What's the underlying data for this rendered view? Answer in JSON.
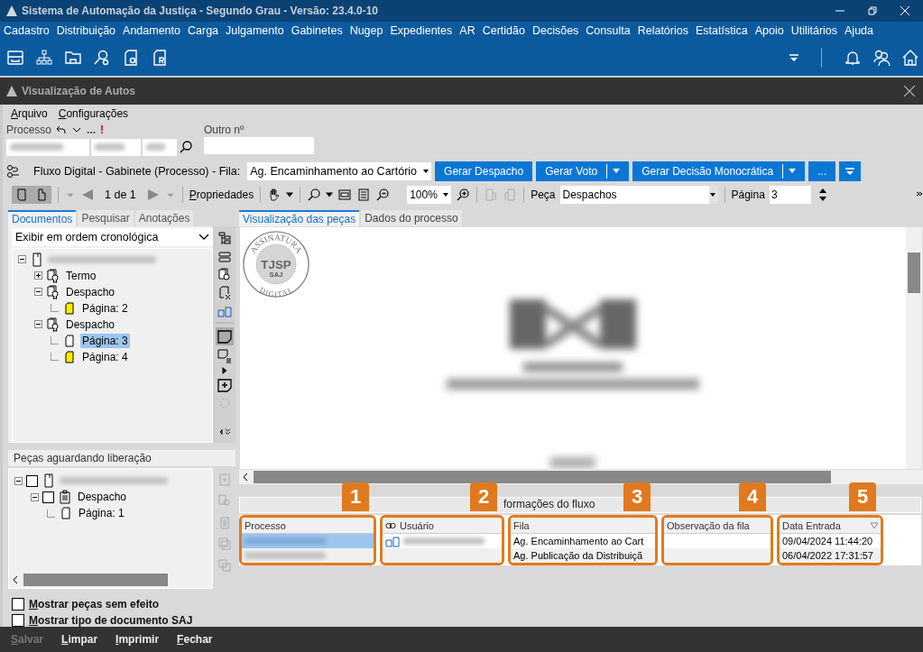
{
  "app_title": "Sistema de Automação da Justiça - Segundo Grau - Versão: 23.4.0-10",
  "menu": [
    "Cadastro",
    "Distribuição",
    "Andamento",
    "Carga",
    "Julgamento",
    "Gabinetes",
    "Nugep",
    "Expedientes",
    "AR",
    "Certidão",
    "Decisões",
    "Consulta",
    "Relatórios",
    "Estatística",
    "Apoio",
    "Utilitários",
    "Ajuda"
  ],
  "window_title": "Visualização de Autos",
  "window_menu": [
    "Arquivo",
    "Configurações"
  ],
  "processo": {
    "label": "Processo",
    "more": "...",
    "alert": "!",
    "other_label": "Outro nº"
  },
  "flow": {
    "label": "Fluxo Digital - Gabinete (Processo) - Fila:",
    "queue": "Ag. Encaminhamento ao Cartório",
    "buttons": [
      {
        "label": "Gerar Despacho",
        "kind": "plain"
      },
      {
        "label": "Gerar Voto",
        "kind": "split"
      },
      {
        "label": "Gerar Decisão Monocrática",
        "kind": "split"
      },
      {
        "label": "...",
        "kind": "plain"
      }
    ]
  },
  "viewer_toolbar": {
    "pages": "1 de 1",
    "properties": "Propriedades",
    "zoom": "100%",
    "piece_label": "Peça",
    "piece": "Despachos",
    "page_label": "Página",
    "page": "3"
  },
  "left_tabs": [
    {
      "label": "Documentos",
      "selected": true
    },
    {
      "label": "Pesquisar",
      "selected": false
    },
    {
      "label": "Anotações",
      "selected": false
    }
  ],
  "order": "Exibir em ordem cronológica",
  "tree": [
    {
      "kind": "process",
      "expanded": true,
      "selected": false,
      "children": [
        {
          "label": "Termo",
          "kind": "document",
          "expanded": false,
          "selected": false
        },
        {
          "label": "Despacho",
          "kind": "document",
          "expanded": true,
          "selected": false,
          "children": [
            {
              "label": "Página: 2",
              "kind": "page",
              "highlighted": true,
              "selected": false
            }
          ]
        },
        {
          "label": "Despacho",
          "kind": "document",
          "expanded": true,
          "selected": false,
          "children": [
            {
              "label": "Página: 3",
              "kind": "page",
              "highlighted": false,
              "selected": true
            },
            {
              "label": "Página: 4",
              "kind": "page",
              "highlighted": true,
              "selected": false
            }
          ]
        }
      ]
    }
  ],
  "pending": {
    "title": "Peças aguardando liberação",
    "tree": [
      {
        "kind": "process",
        "expanded": true,
        "checked": false,
        "children": [
          {
            "label": "Despacho",
            "kind": "document",
            "expanded": true,
            "checked": false,
            "children": [
              {
                "label": "Página: 1",
                "kind": "page"
              }
            ]
          }
        ]
      }
    ]
  },
  "options": [
    {
      "label": "Mostrar peças sem efeito",
      "checked": false
    },
    {
      "label": "Mostrar tipo de documento SAJ",
      "checked": false
    }
  ],
  "right_tabs": [
    {
      "label": "Visualização das peças",
      "selected": true
    },
    {
      "label": "Dados do processo",
      "selected": false
    }
  ],
  "seal": {
    "top": "ASSINATURA",
    "center": "TJSP",
    "small": "SAJ",
    "bottom": "DIGITAL"
  },
  "flow_info": {
    "title": "formações do fluxo",
    "columns": [
      "Processo",
      "Usuário",
      "Fila",
      "Observação da fila",
      "Data Entrada"
    ],
    "rows": [
      {
        "fila": "Ag. Encaminhamento ao Cart",
        "data": "09/04/2024 11:44:20",
        "selected": true
      },
      {
        "fila": "Ag. Publicação da Distribuiçã",
        "data": "06/04/2022 17:31:57",
        "selected": false
      }
    ]
  },
  "callouts": [
    "1",
    "2",
    "3",
    "4",
    "5"
  ],
  "footer": [
    {
      "label": "Salvar",
      "disabled": true
    },
    {
      "label": "Limpar",
      "disabled": false
    },
    {
      "label": "Imprimir",
      "disabled": false
    },
    {
      "label": "Fechar",
      "disabled": false
    }
  ]
}
